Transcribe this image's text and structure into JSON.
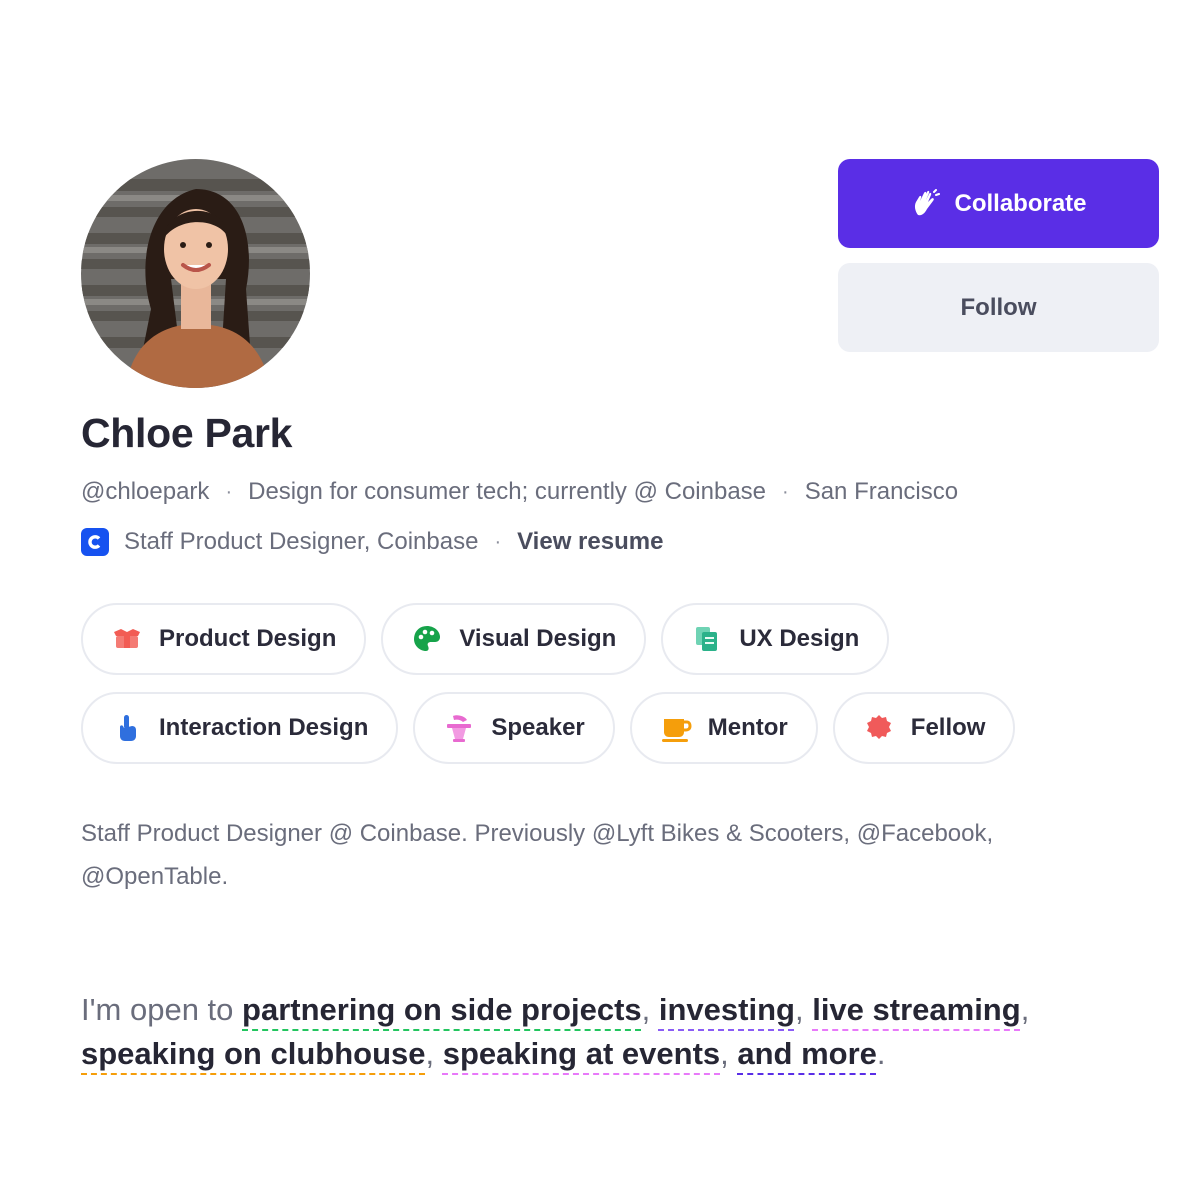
{
  "profile": {
    "name": "Chloe Park",
    "handle": "@chloepark",
    "tagline": "Design for consumer tech; currently @ Coinbase",
    "location": "San Francisco",
    "job_title": "Staff Product Designer, Coinbase",
    "company_logo_icon": "coinbase-logo-icon",
    "view_resume_label": "View resume",
    "separator": "·"
  },
  "actions": {
    "collaborate_label": "Collaborate",
    "collaborate_icon": "waving-hand-icon",
    "follow_label": "Follow",
    "accent_color": "#5a2ee6"
  },
  "tags": {
    "row1": [
      {
        "label": "Product Design",
        "icon": "box-icon",
        "color": "#f25c54"
      },
      {
        "label": "Visual Design",
        "icon": "palette-icon",
        "color": "#16a34a"
      },
      {
        "label": "UX Design",
        "icon": "documents-icon",
        "color": "#2bb28a"
      }
    ],
    "row2": [
      {
        "label": "Interaction Design",
        "icon": "pointing-hand-icon",
        "color": "#2f6fde"
      },
      {
        "label": "Speaker",
        "icon": "podium-icon",
        "color": "#e86ad0"
      },
      {
        "label": "Mentor",
        "icon": "coffee-cup-icon",
        "color": "#f59e0b"
      },
      {
        "label": "Fellow",
        "icon": "badge-icon",
        "color": "#f05a5a"
      }
    ]
  },
  "bio": "Staff Product Designer @ Coinbase. Previously @Lyft Bikes & Scooters, @Facebook, @OpenTable.",
  "open_to": {
    "prefix": "I'm open to ",
    "items": [
      {
        "text": "partnering on side projects",
        "underline_color": "#22c55e"
      },
      {
        "text": "investing",
        "underline_color": "#8b5cf6"
      },
      {
        "text": "live streaming",
        "underline_color": "#e879f9"
      },
      {
        "text": "speaking on clubhouse",
        "underline_color": "#f59e0b"
      },
      {
        "text": "speaking at events",
        "underline_color": "#e879f9"
      },
      {
        "text": "and more",
        "underline_color": "#5a2ee6"
      }
    ],
    "separator": ", ",
    "suffix": "."
  }
}
